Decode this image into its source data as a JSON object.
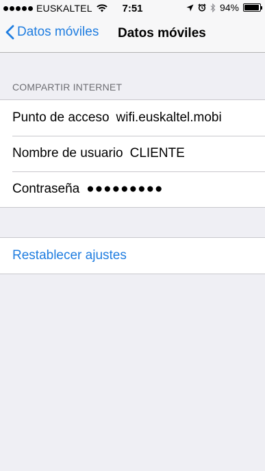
{
  "status_bar": {
    "carrier": "EUSKALTEL",
    "time": "7:51",
    "battery": "94%",
    "battery_level": 0.94,
    "icons": [
      "signal-dots-icon",
      "wifi-icon",
      "location-arrow-icon",
      "alarm-clock-icon",
      "bluetooth-icon",
      "battery-icon"
    ]
  },
  "nav": {
    "back_label": "Datos móviles",
    "title": "Datos móviles"
  },
  "hotspot": {
    "header": "COMPARTIR INTERNET",
    "rows": [
      {
        "label": "Punto de acceso",
        "value": "wifi.euskaltel.mobi"
      },
      {
        "label": "Nombre de usuario",
        "value": "CLIENTE"
      },
      {
        "label": "Contraseña",
        "value": "●●●●●●●●●"
      }
    ]
  },
  "reset": {
    "label": "Restablecer ajustes"
  },
  "colors": {
    "accent": "#1f7de0",
    "background": "#efeff4",
    "header_text": "#6d6d72"
  }
}
